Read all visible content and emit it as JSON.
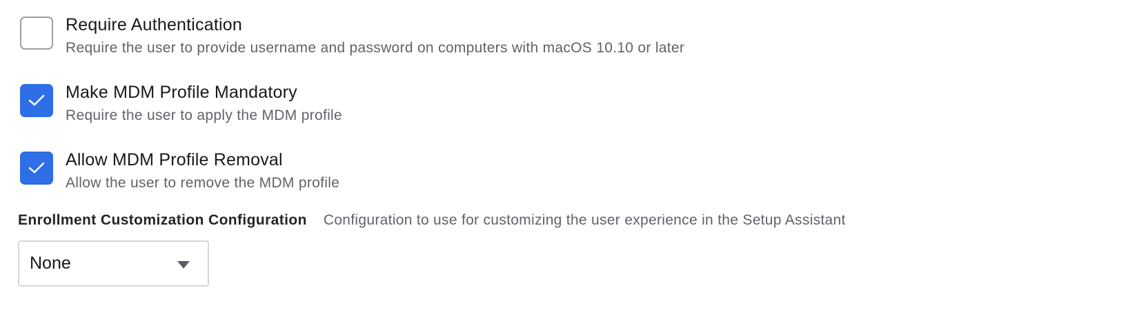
{
  "options": [
    {
      "title": "Require Authentication",
      "description": "Require the user to provide username and password on computers with macOS 10.10 or later",
      "checked": false
    },
    {
      "title": "Make MDM Profile Mandatory",
      "description": "Require the user to apply the MDM profile",
      "checked": true
    },
    {
      "title": "Allow MDM Profile Removal",
      "description": "Allow the user to remove the MDM profile",
      "checked": true
    }
  ],
  "enrollment_customization": {
    "label": "Enrollment Customization Configuration",
    "help": "Configuration to use for customizing the user experience in the Setup Assistant",
    "selected": "None"
  },
  "colors": {
    "accent": "#2e6ee6",
    "checkbox_border": "#9b9ea3",
    "title_text": "#17191c",
    "secondary_text": "#5f6368"
  }
}
